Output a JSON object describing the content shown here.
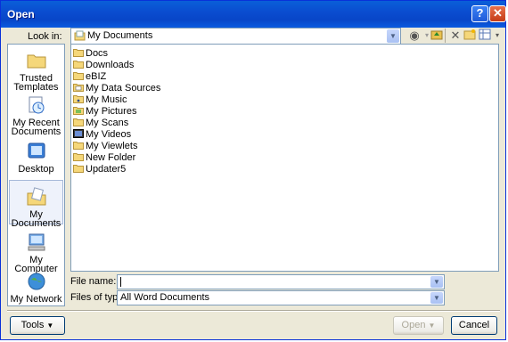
{
  "window": {
    "title": "Open",
    "help_glyph": "?",
    "close_glyph": "✕"
  },
  "look_in": {
    "label": "Look in:",
    "value": "My Documents"
  },
  "places": [
    {
      "label": "Trusted Templates",
      "icon": "folder-icon"
    },
    {
      "label": "My Recent Documents",
      "icon": "recent-documents-icon"
    },
    {
      "label": "Desktop",
      "icon": "desktop-icon"
    },
    {
      "label": "My Documents",
      "icon": "my-documents-icon",
      "selected": true
    },
    {
      "label": "My Computer",
      "icon": "my-computer-icon"
    },
    {
      "label": "My Network",
      "icon": "my-network-icon"
    }
  ],
  "files": [
    {
      "name": "Docs",
      "icon": "folder-icon"
    },
    {
      "name": "Downloads",
      "icon": "folder-icon"
    },
    {
      "name": "eBIZ",
      "icon": "folder-icon"
    },
    {
      "name": "My Data Sources",
      "icon": "data-sources-folder-icon"
    },
    {
      "name": "My Music",
      "icon": "music-folder-icon"
    },
    {
      "name": "My Pictures",
      "icon": "pictures-folder-icon"
    },
    {
      "name": "My Scans",
      "icon": "folder-icon"
    },
    {
      "name": "My Videos",
      "icon": "videos-folder-icon"
    },
    {
      "name": "My Viewlets",
      "icon": "folder-icon"
    },
    {
      "name": "New Folder",
      "icon": "folder-icon"
    },
    {
      "name": "Updater5",
      "icon": "folder-icon"
    }
  ],
  "file_name": {
    "label": "File name:",
    "value": ""
  },
  "file_type": {
    "label": "Files of type:",
    "value": "All Word Documents"
  },
  "buttons": {
    "tools": "Tools",
    "open": "Open",
    "cancel": "Cancel"
  },
  "colors": {
    "titlebar": "#0a4dd0",
    "dialog_bg": "#ece9d8",
    "border": "#7f9db9",
    "folder": "#f5d77a"
  }
}
